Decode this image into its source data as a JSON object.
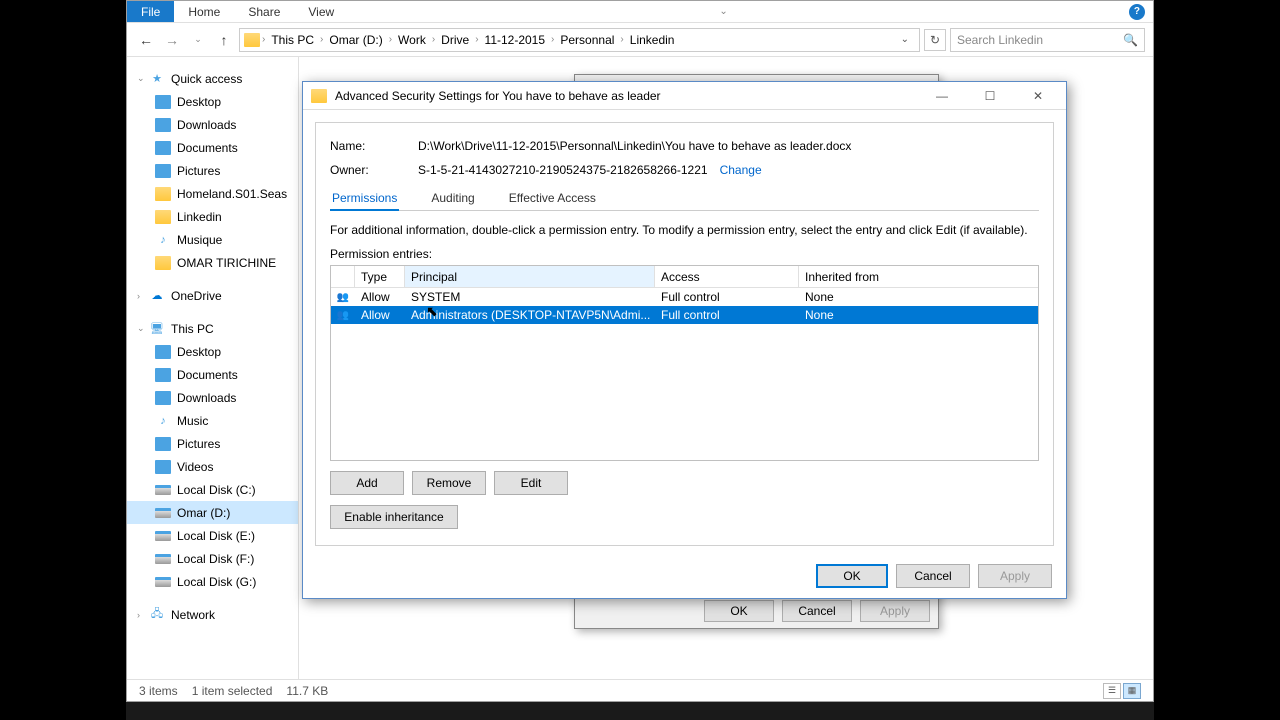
{
  "ribbon": {
    "file": "File",
    "home": "Home",
    "share": "Share",
    "view": "View"
  },
  "breadcrumb": {
    "items": [
      "This PC",
      "Omar (D:)",
      "Work",
      "Drive",
      "11-12-2015",
      "Personnal",
      "Linkedin"
    ]
  },
  "search": {
    "placeholder": "Search Linkedin"
  },
  "tree": {
    "quick_access": "Quick access",
    "qa_items": [
      "Desktop",
      "Downloads",
      "Documents",
      "Pictures",
      "Homeland.S01.Seas",
      "Linkedin",
      "Musique",
      "OMAR TIRICHINE"
    ],
    "onedrive": "OneDrive",
    "this_pc": "This PC",
    "pc_items": [
      "Desktop",
      "Documents",
      "Downloads",
      "Music",
      "Pictures",
      "Videos",
      "Local Disk (C:)",
      "Omar (D:)",
      "Local Disk (E:)",
      "Local Disk (F:)",
      "Local Disk (G:)"
    ],
    "network": "Network"
  },
  "status": {
    "items": "3 items",
    "selected": "1 item selected",
    "size": "11.7 KB"
  },
  "dialog": {
    "title": "Advanced Security Settings for You have to behave as leader",
    "name_label": "Name:",
    "name_value": "D:\\Work\\Drive\\11-12-2015\\Personnal\\Linkedin\\You have to behave as leader.docx",
    "owner_label": "Owner:",
    "owner_value": "S-1-5-21-4143027210-2190524375-2182658266-1221",
    "change": "Change",
    "tabs": {
      "permissions": "Permissions",
      "auditing": "Auditing",
      "effective": "Effective Access"
    },
    "info_text": "For additional information, double-click a permission entry. To modify a permission entry, select the entry and click Edit (if available).",
    "entries_label": "Permission entries:",
    "columns": {
      "type": "Type",
      "principal": "Principal",
      "access": "Access",
      "inherited": "Inherited from"
    },
    "rows": [
      {
        "type": "Allow",
        "principal": "SYSTEM",
        "access": "Full control",
        "inherited": "None"
      },
      {
        "type": "Allow",
        "principal": "Administrators (DESKTOP-NTAVP5N\\Admi...",
        "access": "Full control",
        "inherited": "None"
      }
    ],
    "buttons": {
      "add": "Add",
      "remove": "Remove",
      "edit": "Edit",
      "enable_inherit": "Enable inheritance",
      "ok": "OK",
      "cancel": "Cancel",
      "apply": "Apply"
    }
  },
  "props": {
    "ok": "OK",
    "cancel": "Cancel",
    "apply": "Apply"
  }
}
